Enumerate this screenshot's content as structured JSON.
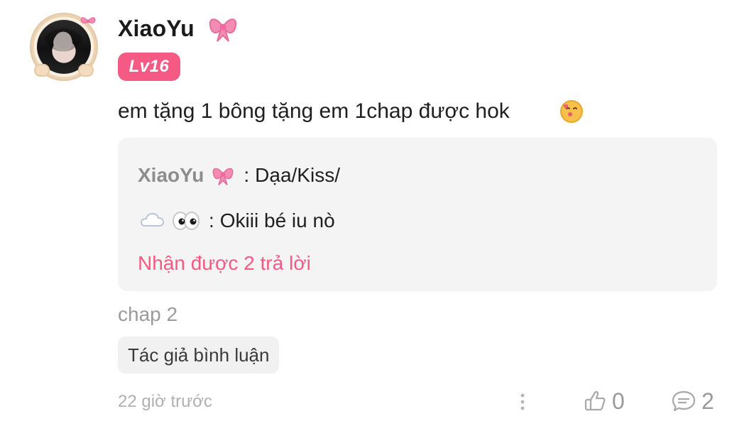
{
  "user": {
    "name": "XiaoYu",
    "level_badge": "Lv16"
  },
  "comment": {
    "text": "em tặng 1 bông tặng em 1chap được hok"
  },
  "replies": {
    "items": [
      {
        "author": "XiaoYu",
        "text": "Dạa/Kiss/"
      },
      {
        "author": "",
        "text": "Okiii bé iu nò"
      }
    ],
    "summary": "Nhận được 2 trả lời"
  },
  "meta": {
    "chapter": "chap 2",
    "tag": "Tác giả bình luận",
    "time_ago": "22 giờ trước"
  },
  "actions": {
    "like_count": "0",
    "reply_count": "2"
  },
  "colors": {
    "accent_pink": "#f45a84",
    "muted_gray": "#9b9b9b",
    "box_bg": "#f4f4f4"
  },
  "icons": {
    "bow": "bow-icon",
    "kiss": "kiss-emoji-icon",
    "cloud": "cloud-emoji-icon",
    "eyes": "eyes-emoji-icon",
    "more": "more-vertical-icon",
    "like": "thumbs-up-icon",
    "reply": "chat-bubble-icon"
  }
}
